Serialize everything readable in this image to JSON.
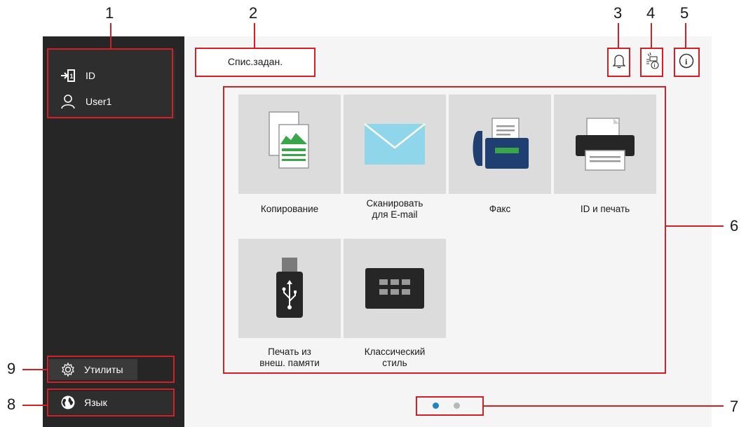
{
  "callouts": [
    "1",
    "2",
    "3",
    "4",
    "5",
    "6",
    "7",
    "8",
    "9"
  ],
  "sidebar": {
    "user_panel": {
      "id_label": "ID",
      "user_label": "User1"
    },
    "utilities_label": "Утилиты",
    "language_label": "Язык"
  },
  "header": {
    "job_list_label": "Спис.задан."
  },
  "tiles": [
    {
      "label_line1": "Копирование",
      "label_line2": "",
      "icon": "copy-icon"
    },
    {
      "label_line1": "Сканировать",
      "label_line2": "для E-mail",
      "icon": "envelope-icon"
    },
    {
      "label_line1": "Факс",
      "label_line2": "",
      "icon": "fax-icon"
    },
    {
      "label_line1": "ID и печать",
      "label_line2": "",
      "icon": "printer-icon"
    },
    {
      "label_line1": "Печать из",
      "label_line2": "внеш. памяти",
      "icon": "usb-drive-icon"
    },
    {
      "label_line1": "Классический",
      "label_line2": "стиль",
      "icon": "keypad-icon"
    }
  ],
  "pagination": {
    "current_page": 1,
    "total_pages": 2
  },
  "colors": {
    "callout_red": "#d32027",
    "sidebar_bg": "#262626",
    "tile_bg": "#dcdcdc",
    "accent_green": "#3aa64a",
    "envelope_blue": "#8fd6ea",
    "device_navy": "#1f3f73",
    "active_dot": "#1f84c6"
  }
}
